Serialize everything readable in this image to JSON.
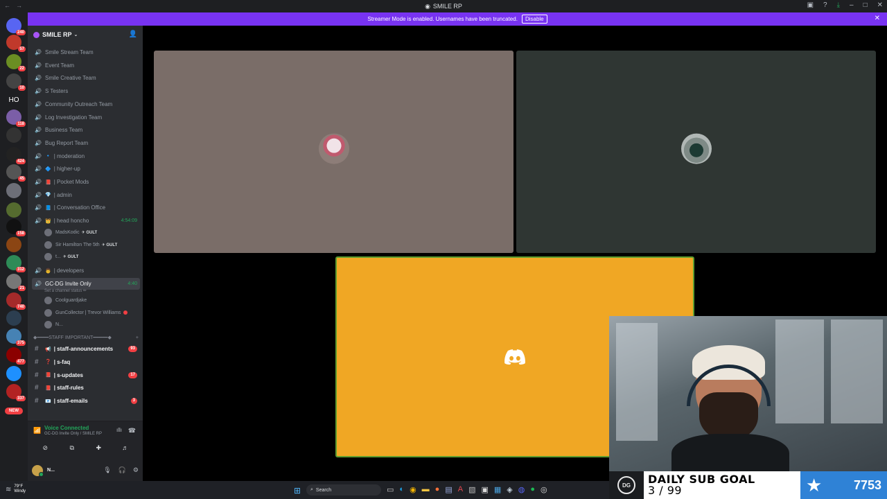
{
  "window": {
    "title": "SMILE RP"
  },
  "banner": {
    "text": "Streamer Mode is enabled. Usernames have been truncated.",
    "button": "Disable"
  },
  "rail": {
    "servers": [
      {
        "badge": "240",
        "color": "#5865f2"
      },
      {
        "badge": "57",
        "color": "#c0392b"
      },
      {
        "badge": "22",
        "color": "#6b8e23"
      },
      {
        "badge": "10",
        "color": "#444"
      },
      {
        "label": "HO"
      },
      {
        "badge": "118",
        "color": "#7b5ea7"
      },
      {
        "badge": "",
        "color": "#333"
      },
      {
        "badge": "424",
        "color": "#222"
      },
      {
        "badge": "45",
        "color": "#555"
      },
      {
        "badge": "",
        "color": "#6d6f78"
      },
      {
        "badge": "",
        "color": "#556b2f"
      },
      {
        "badge": "158",
        "color": "#111"
      },
      {
        "badge": "",
        "color": "#8b4513"
      },
      {
        "badge": "312",
        "color": "#2e8b57"
      },
      {
        "badge": "21",
        "color": "#777"
      },
      {
        "badge": "740",
        "color": "#a52a2a"
      },
      {
        "badge": "",
        "color": "#2c3e50"
      },
      {
        "badge": "375",
        "color": "#4682b4"
      },
      {
        "badge": "477",
        "color": "#8b0000"
      },
      {
        "badge": "",
        "color": "#1e90ff"
      },
      {
        "badge": "337",
        "color": "#b22222"
      },
      {
        "label": "NEW"
      }
    ]
  },
  "sidebar": {
    "server_name": "SMILE RP",
    "voice_channels": [
      {
        "name": "Smile Stream Team"
      },
      {
        "name": "Event Team"
      },
      {
        "name": "Smile Creative Team"
      },
      {
        "name": "S Testers"
      },
      {
        "name": "Community Outreach Team"
      },
      {
        "name": "Log Investigation Team"
      },
      {
        "name": "Business Team"
      },
      {
        "name": "Bug Report Team"
      },
      {
        "name": "| moderation",
        "emoji": "🔹"
      },
      {
        "name": "| higher-up",
        "emoji": "🔷"
      },
      {
        "name": "| Pocket Mods",
        "emoji": "📕"
      },
      {
        "name": "| admin",
        "emoji": "💎"
      },
      {
        "name": "| Conversation Office",
        "emoji": "📘"
      },
      {
        "name": "| head honcho",
        "emoji": "👑",
        "timer": "4:54:09"
      }
    ],
    "head_honcho_members": [
      {
        "name": "MadsKodic",
        "tag": "✈ GULT"
      },
      {
        "name": "Sir Hamilton The 5th",
        "tag": "✈ GULT"
      },
      {
        "name": "t...",
        "tag": "✈ GULT"
      }
    ],
    "developers": {
      "name": "| developers",
      "emoji": "👨"
    },
    "gc_channel": {
      "name": "GC-DG Invite Only",
      "timer": "4:40",
      "status": "Set a channel status ✏"
    },
    "gc_members": [
      {
        "name": "Coolguardjake"
      },
      {
        "name": "GunCollector | Trevor Williams"
      },
      {
        "name": "N..."
      }
    ],
    "category": {
      "label": "STAFF IMPORTANT",
      "prefix": "◆━━━━ ",
      "suffix": " ━━━━━◆"
    },
    "text_channels": [
      {
        "name": "| staff-announcements",
        "emoji": "📢",
        "count": "93"
      },
      {
        "name": "| s-faq",
        "emoji": "❓",
        "count": ""
      },
      {
        "name": "| s-updates",
        "emoji": "📕",
        "count": "17"
      },
      {
        "name": "| staff-rules",
        "emoji": "📕",
        "count": ""
      },
      {
        "name": "| staff-emails",
        "emoji": "📧",
        "count": "3"
      }
    ]
  },
  "voice": {
    "title": "Voice Connected",
    "subtitle": "GC-DG Invite Only / SMILE RP"
  },
  "user": {
    "name": "N...",
    "sub": "N..."
  },
  "video": {
    "tile1_color": "#7a6d68",
    "tile2_color": "#2f3633",
    "tile3_color": "#f0a724"
  },
  "subgoal": {
    "title": "DAILY SUB GOAL",
    "count": "3 / 99",
    "total": "7753",
    "logo": "DG"
  },
  "taskbar": {
    "temp": "79°F",
    "weather": "Windy",
    "search_placeholder": "Search"
  }
}
